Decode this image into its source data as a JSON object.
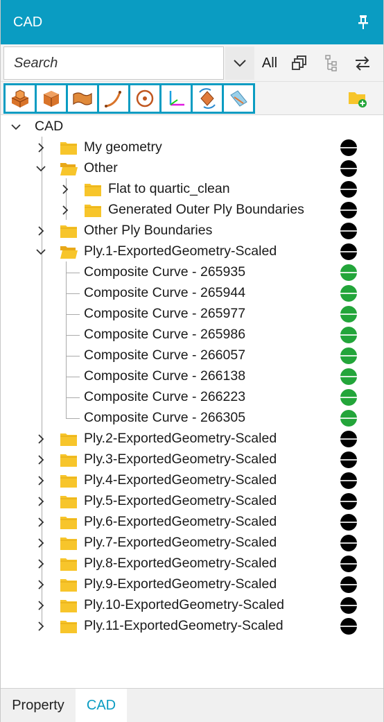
{
  "panel": {
    "title": "CAD"
  },
  "search": {
    "placeholder": "Search",
    "filter_label": "All"
  },
  "tree": {
    "root": {
      "label": "CAD"
    },
    "my_geometry": {
      "label": "My geometry"
    },
    "other": {
      "label": "Other"
    },
    "flat_to_quartic": {
      "label": "Flat to quartic_clean"
    },
    "generated_outer": {
      "label": "Generated Outer Ply Boundaries"
    },
    "other_ply_boundaries": {
      "label": "Other Ply Boundaries"
    },
    "ply1": {
      "label": "Ply.1-ExportedGeometry-Scaled"
    },
    "curves": [
      {
        "label": "Composite Curve - 265935"
      },
      {
        "label": "Composite Curve - 265944"
      },
      {
        "label": "Composite Curve - 265977"
      },
      {
        "label": "Composite Curve - 265986"
      },
      {
        "label": "Composite Curve - 266057"
      },
      {
        "label": "Composite Curve - 266138"
      },
      {
        "label": "Composite Curve - 266223"
      },
      {
        "label": "Composite Curve - 266305"
      }
    ],
    "plies": [
      {
        "label": "Ply.2-ExportedGeometry-Scaled"
      },
      {
        "label": "Ply.3-ExportedGeometry-Scaled"
      },
      {
        "label": "Ply.4-ExportedGeometry-Scaled"
      },
      {
        "label": "Ply.5-ExportedGeometry-Scaled"
      },
      {
        "label": "Ply.6-ExportedGeometry-Scaled"
      },
      {
        "label": "Ply.7-ExportedGeometry-Scaled"
      },
      {
        "label": "Ply.8-ExportedGeometry-Scaled"
      },
      {
        "label": "Ply.9-ExportedGeometry-Scaled"
      },
      {
        "label": "Ply.10-ExportedGeometry-Scaled"
      },
      {
        "label": "Ply.11-ExportedGeometry-Scaled"
      }
    ]
  },
  "tabs": {
    "property": "Property",
    "cad": "CAD"
  },
  "colors": {
    "accent": "#0a9cc2",
    "visible_green": "#23a53a",
    "hidden_black": "#000000",
    "folder": "#f7c52b"
  },
  "icons": [
    "pin-icon",
    "chevron-down-icon",
    "stack-icon",
    "hierarchy-icon",
    "swap-icon",
    "extrude-solid-icon",
    "box-solid-icon",
    "surface-icon",
    "curve-icon",
    "point-icon",
    "axis-system-icon",
    "transform-icon",
    "plane-icon",
    "folder-add-icon",
    "folder-icon",
    "folder-open-icon",
    "expand-chevron-icon",
    "visibility-dot-icon"
  ]
}
